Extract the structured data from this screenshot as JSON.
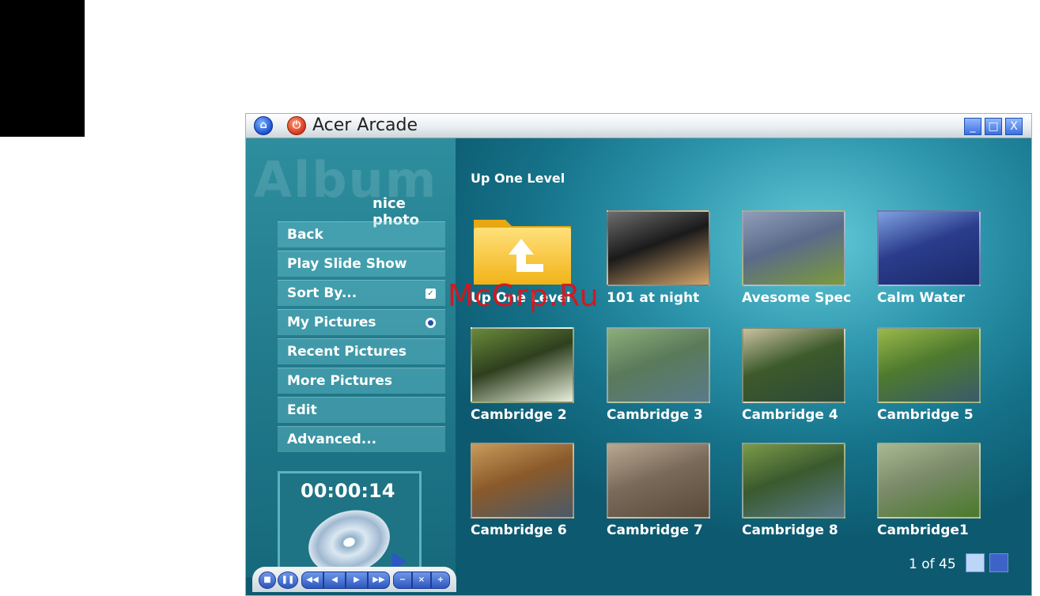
{
  "app": {
    "title": "Acer Arcade"
  },
  "titlebar": {
    "minimize": "_",
    "maximize": "□",
    "close": "X"
  },
  "sidebar": {
    "section_word": "Album",
    "folder_name": "nice photo",
    "menu": [
      {
        "label": "Back"
      },
      {
        "label": "Play Slide Show"
      },
      {
        "label": "Sort By...",
        "marker": "checkbox"
      },
      {
        "label": "My Pictures",
        "marker": "radio",
        "selected": true
      },
      {
        "label": "Recent Pictures"
      },
      {
        "label": "More Pictures"
      },
      {
        "label": "Edit"
      },
      {
        "label": "Advanced..."
      }
    ],
    "timer": "00:00:14"
  },
  "transport": [
    "stop",
    "pause",
    "prev",
    "rewind",
    "fast-forward",
    "next",
    "volume-down",
    "mute",
    "volume-up"
  ],
  "main": {
    "breadcrumb": "Up One Level",
    "items": [
      {
        "caption": "Up One Level",
        "type": "folder"
      },
      {
        "caption": "101 at night",
        "type": "photo",
        "colors": [
          "#1a1a1a",
          "#6d6d6d",
          "#d4a56a"
        ]
      },
      {
        "caption": "Avesome Spec",
        "type": "photo",
        "colors": [
          "#5a6b8a",
          "#8f9db8",
          "#7c9a3a"
        ]
      },
      {
        "caption": "Calm Water",
        "type": "photo",
        "colors": [
          "#2a3c8c",
          "#7fa0e0",
          "#1c2a6a"
        ]
      },
      {
        "caption": "Cambridge 2",
        "type": "photo",
        "colors": [
          "#2e3f1e",
          "#6a8a3a",
          "#e8eedc"
        ]
      },
      {
        "caption": "Cambridge 3",
        "type": "photo",
        "colors": [
          "#5a7a5a",
          "#8cae7a",
          "#5a7a8a"
        ]
      },
      {
        "caption": "Cambridge 4",
        "type": "photo",
        "colors": [
          "#3c5a2a",
          "#c8c0a0",
          "#2e4a3a"
        ]
      },
      {
        "caption": "Cambridge 5",
        "type": "photo",
        "colors": [
          "#4e7a2e",
          "#9ab84a",
          "#3a5a6a"
        ]
      },
      {
        "caption": "Cambridge 6",
        "type": "photo",
        "colors": [
          "#8a5a2a",
          "#c89a5a",
          "#4a5a6a"
        ]
      },
      {
        "caption": "Cambridge 7",
        "type": "photo",
        "colors": [
          "#7a6a5a",
          "#b8a890",
          "#5a4a3a"
        ]
      },
      {
        "caption": "Cambridge 8",
        "type": "photo",
        "colors": [
          "#3a5a2e",
          "#7a9a4a",
          "#5a7a8a"
        ]
      },
      {
        "caption": "Cambridge1",
        "type": "photo",
        "colors": [
          "#7a8a6a",
          "#a8b890",
          "#4a7a2a"
        ]
      }
    ]
  },
  "pager": {
    "text": "1 of 45"
  },
  "watermark": "McGrp.Ru"
}
